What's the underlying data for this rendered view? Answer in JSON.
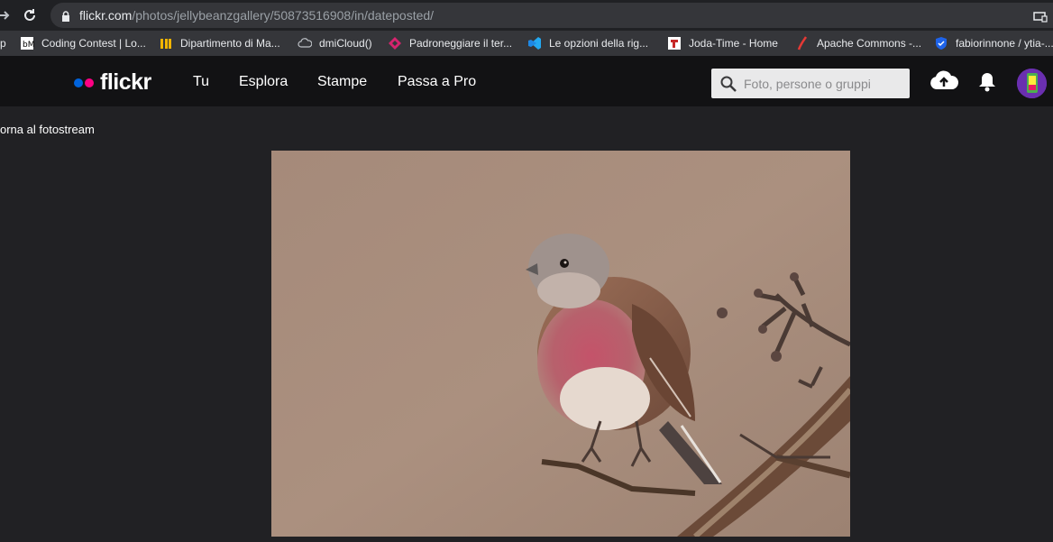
{
  "browser": {
    "url_host": "flickr.com",
    "url_path": "/photos/jellybeanzgallery/50873516908/in/dateposted/",
    "bookmarks": [
      {
        "label": "p",
        "icon": "truncated-icon"
      },
      {
        "label": "Coding Contest | Lo...",
        "icon": "bm-logo-icon"
      },
      {
        "label": "Dipartimento di Ma...",
        "icon": "unimi-icon"
      },
      {
        "label": "dmiCloud()",
        "icon": "cloud-icon"
      },
      {
        "label": "Padroneggiare il ter...",
        "icon": "diamond-icon"
      },
      {
        "label": "Le opzioni della rig...",
        "icon": "vscode-icon"
      },
      {
        "label": "Joda-Time - Home",
        "icon": "joda-icon"
      },
      {
        "label": "Apache Commons -...",
        "icon": "feather-icon"
      },
      {
        "label": "fabiorinnone / ytia-...",
        "icon": "shield-icon"
      }
    ]
  },
  "flickr": {
    "logo": "flickr",
    "nav": [
      "Tu",
      "Esplora",
      "Stampe",
      "Passa a Pro"
    ],
    "search_placeholder": "Foto, persone o gruppi"
  },
  "content": {
    "back_link": "orna al fotostream"
  },
  "colors": {
    "flickr_blue": "#0063dc",
    "flickr_pink": "#ff0084",
    "header_bg": "#121214",
    "page_bg": "#212124"
  }
}
